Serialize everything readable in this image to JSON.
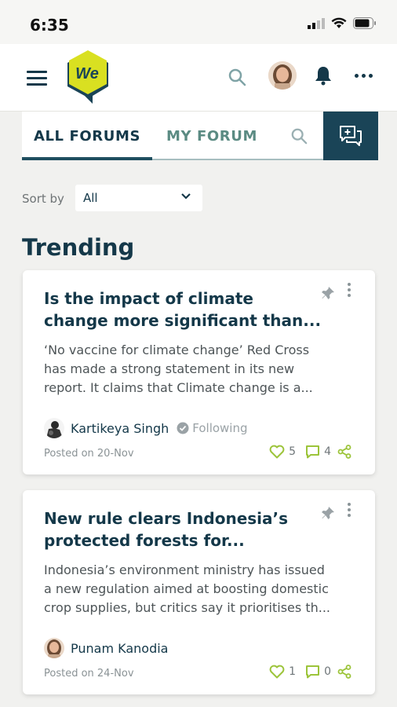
{
  "status_bar": {
    "time": "6:35"
  },
  "header": {
    "logo_text": "We"
  },
  "tabs": [
    {
      "label": "ALL FORUMS",
      "active": true
    },
    {
      "label": "MY FORUM",
      "active": false
    }
  ],
  "sort": {
    "label": "Sort by",
    "selected": "All"
  },
  "section_title": "Trending",
  "posts": [
    {
      "title_line1": "Is the impact of climate",
      "title_line2": "change more significant than...",
      "excerpt_line1": "‘No vaccine for climate change’ Red Cross",
      "excerpt_line2": "has made a strong statement in its new",
      "excerpt_line3": "report. It claims that Climate change is a...",
      "author": "Kartikeya Singh",
      "follow_status": "Following",
      "posted": "Posted on 20-Nov",
      "likes": "5",
      "comments": "4"
    },
    {
      "title_line1": "New rule clears Indonesia’s",
      "title_line2": "protected forests for...",
      "excerpt_line1": "Indonesia’s environment ministry has issued",
      "excerpt_line2": "a new regulation aimed at boosting domestic",
      "excerpt_line3": "crop supplies, but critics say it prioritises th...",
      "author": "Punam Kanodia",
      "posted": "Posted on 24-Nov",
      "likes": "1",
      "comments": "0"
    }
  ],
  "colors": {
    "primary": "#143849",
    "accent_green": "#9cc43a",
    "tab_inactive": "#5b8b83",
    "compose_bg": "#1a4457",
    "logo_yellow": "#d9e021"
  }
}
